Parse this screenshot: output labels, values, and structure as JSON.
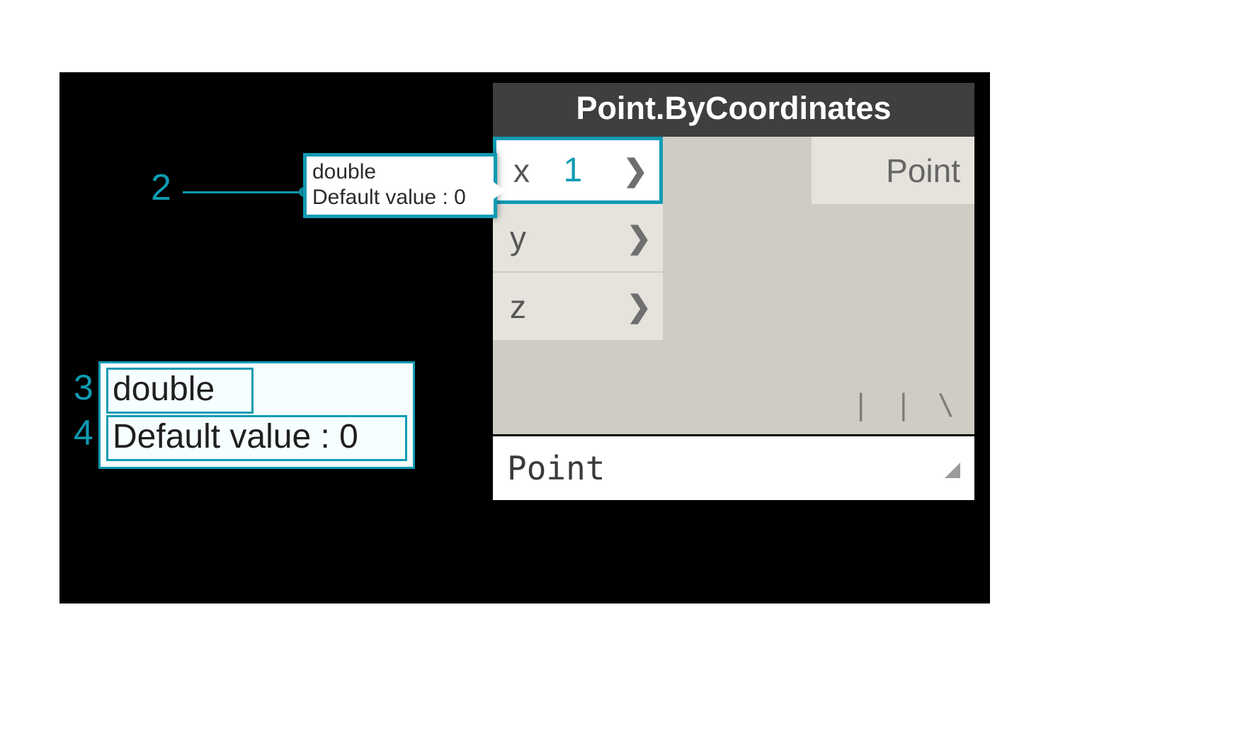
{
  "canvas": {
    "background": "black"
  },
  "node": {
    "title": "Point.ByCoordinates",
    "inputs": [
      {
        "name": "x",
        "annotation": "1",
        "active": true
      },
      {
        "name": "y",
        "annotation": "",
        "active": false
      },
      {
        "name": "z",
        "annotation": "",
        "active": false
      }
    ],
    "output_label": "Point",
    "lacing_glyph": "| | \\",
    "footer_result": "Point"
  },
  "tooltip": {
    "type_line": "double",
    "default_line": "Default value : 0"
  },
  "zoom_tooltip": {
    "type_line": "double",
    "default_line": "Default value : 0"
  },
  "callouts": {
    "c2": "2",
    "c3": "3",
    "c4": "4"
  }
}
